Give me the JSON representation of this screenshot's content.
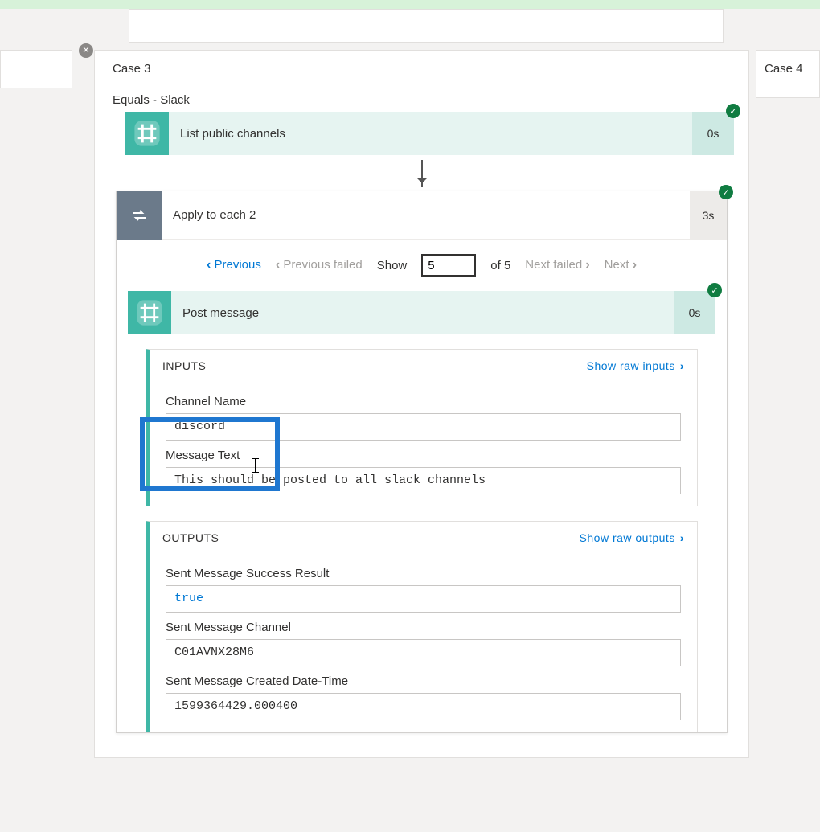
{
  "cases": {
    "current": "Case 3",
    "next": "Case 4"
  },
  "condition": "Equals - Slack",
  "slack_list": {
    "label": "List public channels",
    "duration": "0s"
  },
  "loop": {
    "label": "Apply to each 2",
    "duration": "3s"
  },
  "pager": {
    "previous": "Previous",
    "previous_failed": "Previous failed",
    "show": "Show",
    "value": "5",
    "of_total": "of 5",
    "next_failed": "Next failed",
    "next": "Next"
  },
  "post": {
    "label": "Post message",
    "duration": "0s"
  },
  "inputs": {
    "title": "INPUTS",
    "show_raw": "Show raw inputs",
    "channel_name_label": "Channel Name",
    "channel_name_value": "discord",
    "message_text_label": "Message Text",
    "message_text_value": "This should be posted to all slack channels"
  },
  "outputs": {
    "title": "OUTPUTS",
    "show_raw": "Show raw outputs",
    "success_label": "Sent Message Success Result",
    "success_value": "true",
    "channel_label": "Sent Message Channel",
    "channel_value": "C01AVNX28M6",
    "created_label": "Sent Message Created Date-Time",
    "created_value": "1599364429.000400"
  }
}
